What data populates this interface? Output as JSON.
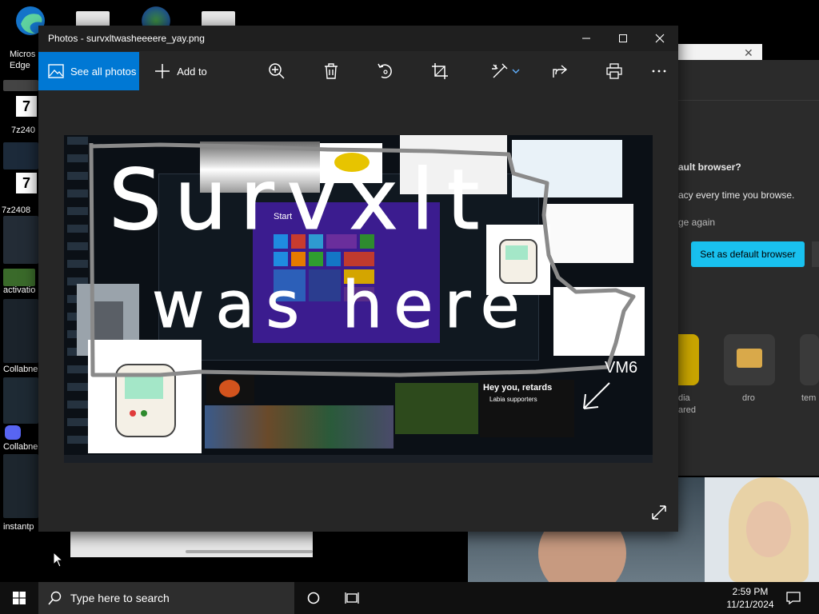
{
  "desktop": {
    "icons": [
      {
        "label": "Micros Edge"
      },
      {
        "label": "7z240"
      },
      {
        "label": "7z2408"
      },
      {
        "label": "activatio"
      },
      {
        "label": "Collabne"
      },
      {
        "label": "Collabne"
      },
      {
        "label": "instantp"
      }
    ]
  },
  "background_edge": {
    "prompt_line1": "ault browser?",
    "prompt_line2": "acy every time you browse.",
    "prompt_line3": "ge again",
    "default_button": "Set as default browser",
    "tiles": [
      {
        "label": "dia"
      },
      {
        "label": "ared"
      },
      {
        "label": "dro"
      },
      {
        "label": "tem"
      }
    ]
  },
  "photos_window": {
    "title": "Photos - survxltwasheeeere_yay.png",
    "see_all_photos": "See all photos",
    "add_to": "Add to",
    "toolbar_icons": [
      "zoom-in-icon",
      "delete-icon",
      "rotate-icon",
      "crop-icon",
      "edit-icon",
      "share-icon",
      "print-icon",
      "more-icon"
    ]
  },
  "image_content": {
    "drawn_line1": "Survxlt",
    "drawn_line2": "was here",
    "drawn_tag": "VM6",
    "start_label": "Start",
    "banner": "Hey you, retards",
    "banner_sub": "Labia supporters"
  },
  "taskbar": {
    "search_placeholder": "Type here to search",
    "time": "2:59 PM",
    "date": "11/21/2024"
  }
}
